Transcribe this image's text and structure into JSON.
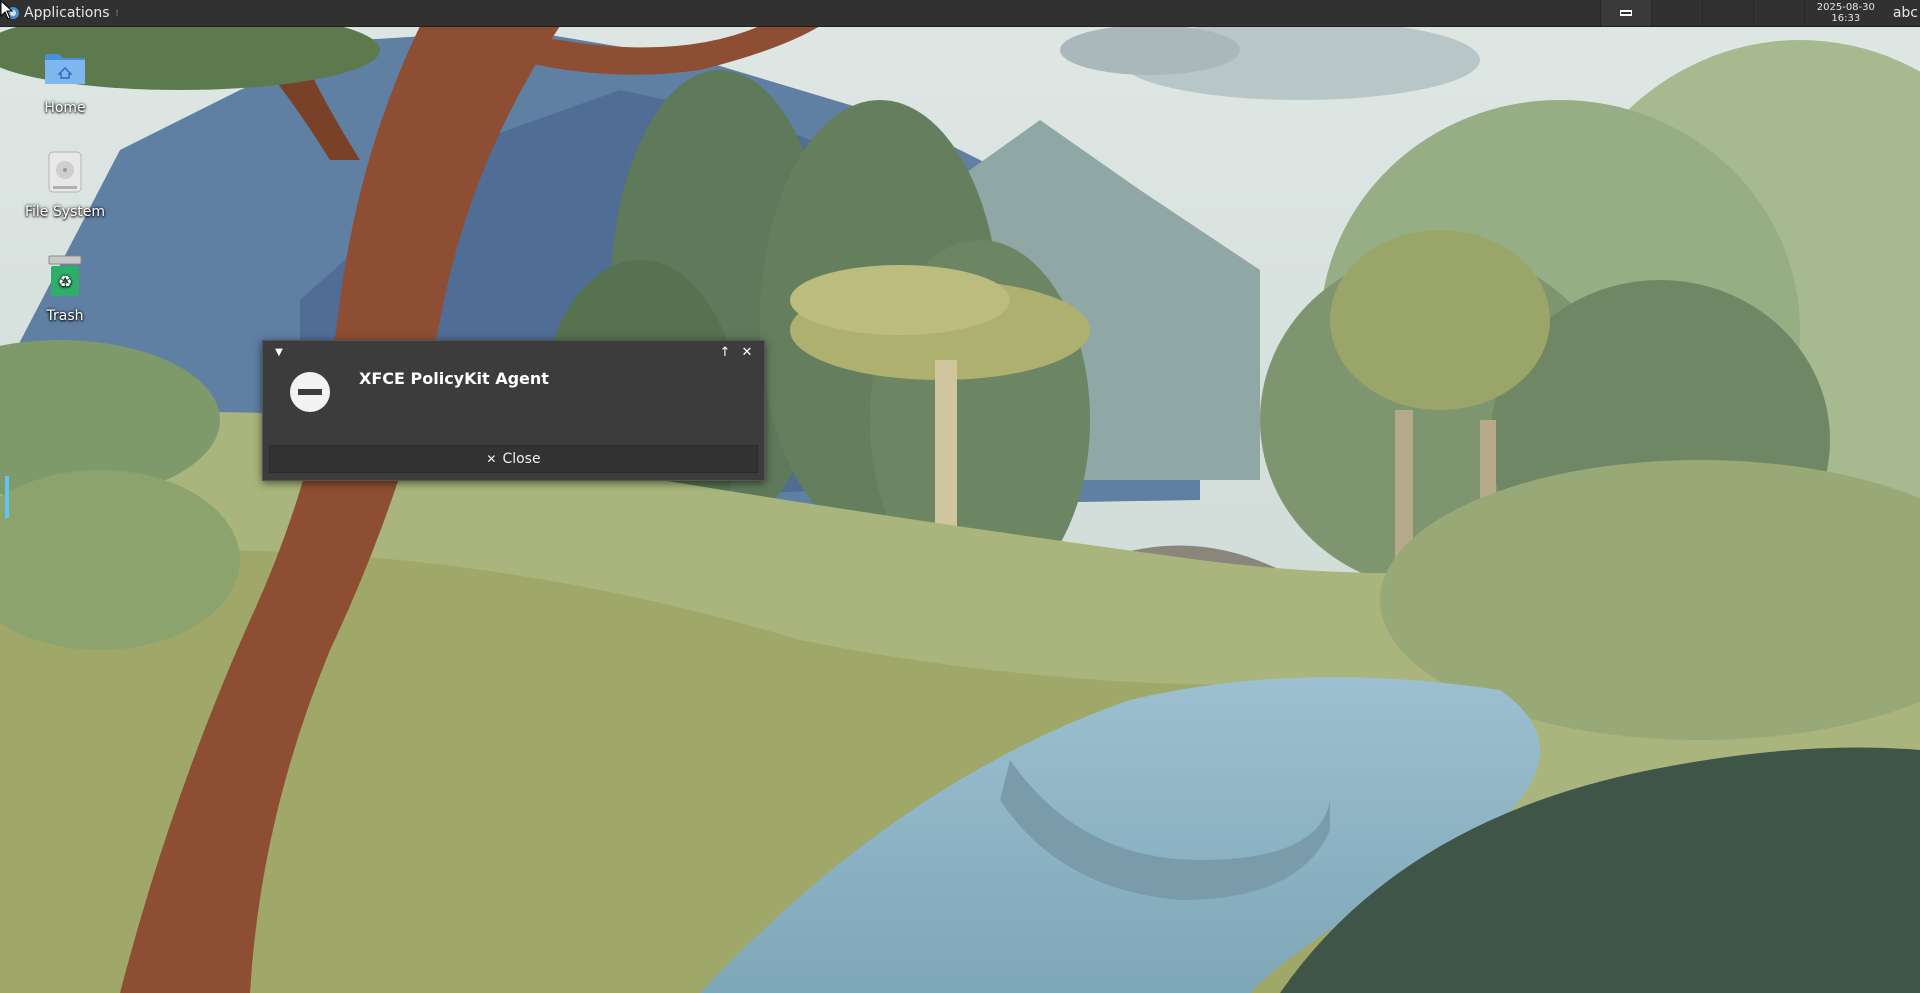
{
  "panel": {
    "apps_label": "Applications",
    "apps_dots": "⁝",
    "clock": {
      "date": "2025-08-30",
      "time": "16:33"
    },
    "keyboard_layout": "abc"
  },
  "desktop": {
    "icons": [
      {
        "label": "Home",
        "icon": "home-folder-icon"
      },
      {
        "label": "File System",
        "icon": "hard-drive-icon"
      },
      {
        "label": "Trash",
        "icon": "trash-icon"
      }
    ]
  },
  "dialog": {
    "title": "XFCE PolicyKit Agent",
    "close_label": "Close",
    "close_symbol": "✕",
    "icon": "error-stop-icon"
  },
  "colors": {
    "panel_bg": "#313131",
    "dialog_bg": "#3c3c3c",
    "accent": "#5ec6f0"
  }
}
